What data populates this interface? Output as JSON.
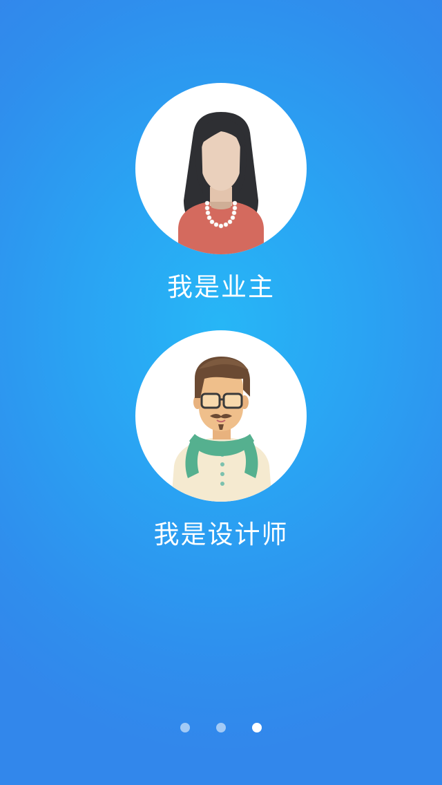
{
  "roles": {
    "owner": {
      "label": "我是业主",
      "icon": "woman-avatar-icon"
    },
    "designer": {
      "label": "我是设计师",
      "icon": "man-designer-avatar-icon"
    }
  },
  "pager": {
    "total": 3,
    "active_index": 2
  },
  "colors": {
    "background_center": "#27b6f6",
    "background_edge": "#3287eb",
    "text": "#ffffff"
  }
}
